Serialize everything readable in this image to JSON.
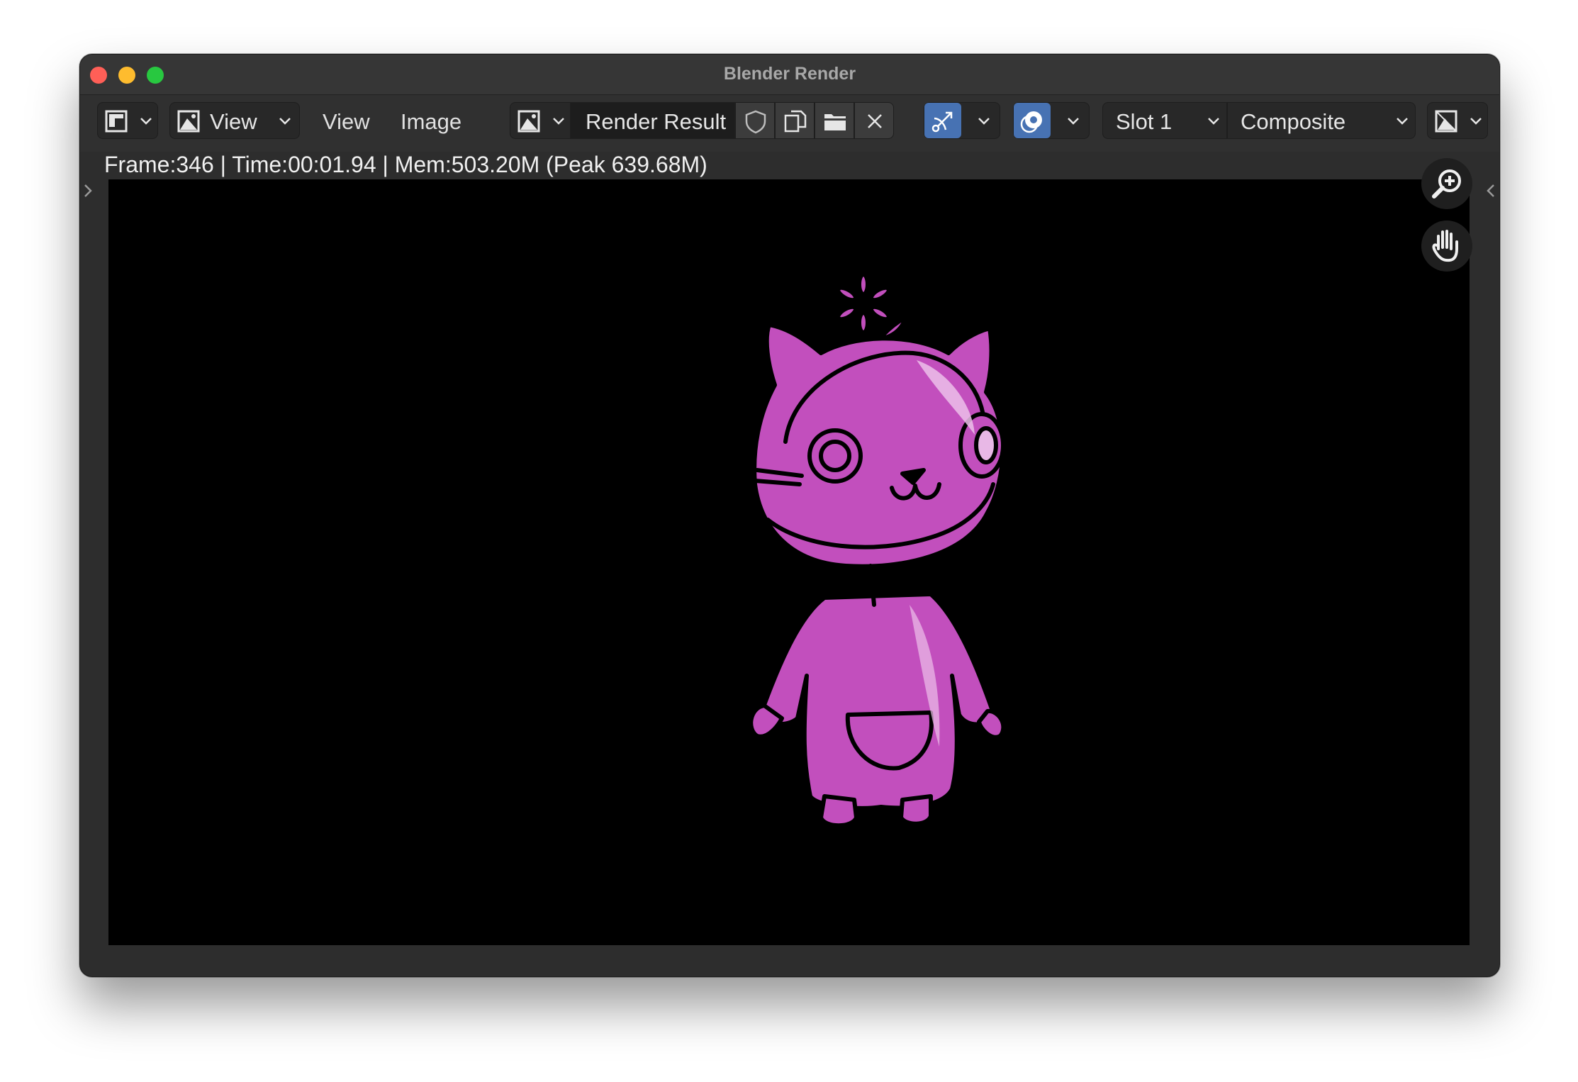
{
  "window": {
    "title": "Blender Render"
  },
  "header": {
    "editor_type_icon": "image-editor-icon",
    "view_dropdown": "View",
    "menus": [
      "View",
      "Image"
    ],
    "image_name": "Render Result",
    "slot": "Slot 1",
    "layer": "Composite"
  },
  "status": {
    "frame": "Frame:346",
    "time": "Time:00:01.94",
    "mem": "Mem:503.20M (Peak 639.68M)"
  },
  "colors": {
    "accent_blue": "#4772b3",
    "character_fill": "#c24fbd"
  }
}
